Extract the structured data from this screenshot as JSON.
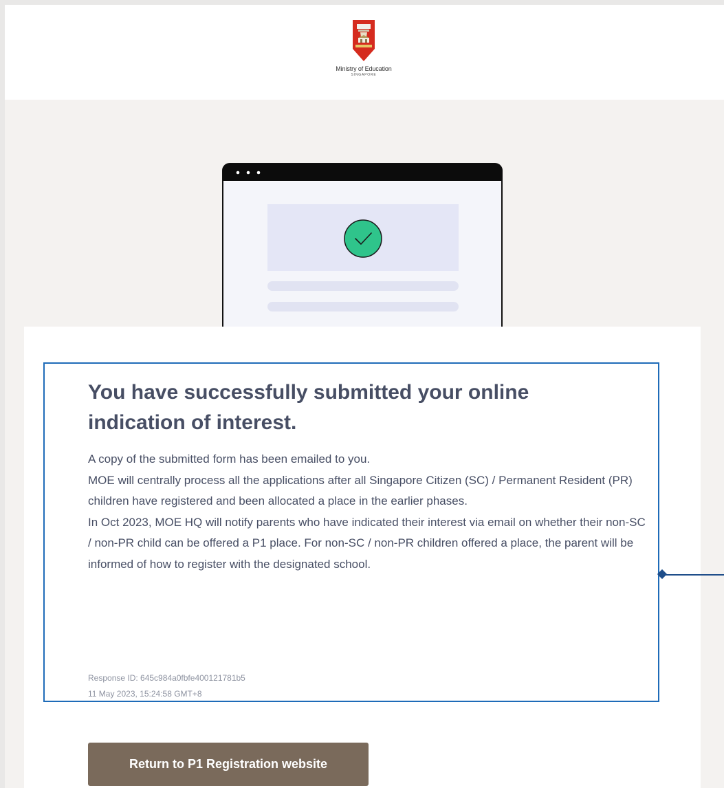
{
  "header": {
    "org_name": "Ministry of Education",
    "org_sub": "SINGAPORE"
  },
  "confirmation": {
    "title": "You have successfully submitted your online indication of interest.",
    "paragraphs": [
      "A copy of the submitted form has been emailed to you.",
      "MOE will centrally process all the applications after all Singapore Citizen (SC) / Permanent Resident (PR) children have registered and been allocated a place in the earlier phases.",
      "In Oct 2023, MOE HQ will notify parents who have indicated their interest via email on whether their non-SC / non-PR child can be offered a P1 place. For non-SC / non-PR children offered a place, the parent will be informed of how to register with the designated school."
    ],
    "response_id": "Response ID: 645c984a0fbfe400121781b5",
    "timestamp": "11 May 2023, 15:24:58 GMT+8"
  },
  "actions": {
    "return_label": "Return to P1 Registration website"
  },
  "icons": {
    "logo": "moe-crest-icon",
    "success": "check-circle-icon"
  },
  "colors": {
    "button": "#7a6a5b",
    "success": "#2fc48b",
    "highlight": "#1e6bb8",
    "text": "#474e64"
  }
}
